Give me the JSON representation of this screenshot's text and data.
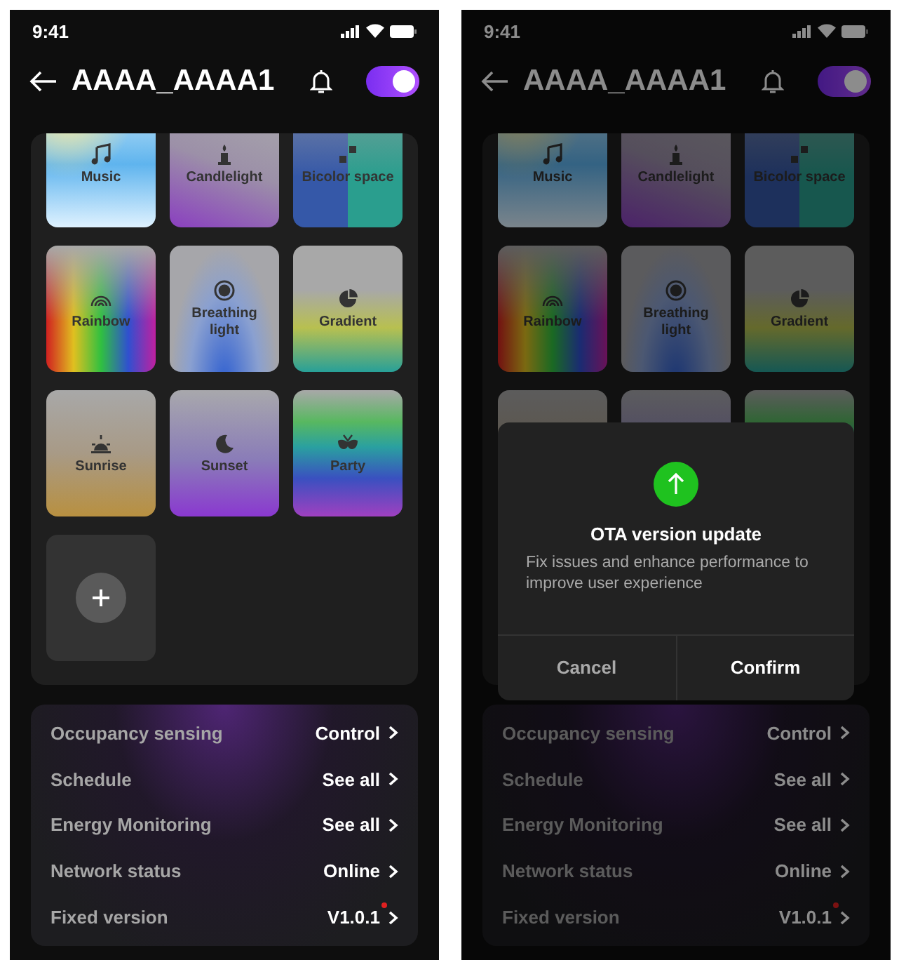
{
  "screens": [
    {
      "status_bar": {
        "time": "9:41"
      },
      "header": {
        "title": "AAAA_AAAA1",
        "power_on": true
      },
      "tiles": [
        {
          "kind": "music",
          "label": "Music"
        },
        {
          "kind": "candle",
          "label": "Candlelight"
        },
        {
          "kind": "bicolor",
          "label": "Bicolor space"
        },
        {
          "kind": "rainbow",
          "label": "Rainbow"
        },
        {
          "kind": "breathing",
          "label": "Breathing light"
        },
        {
          "kind": "gradient",
          "label": "Gradient"
        },
        {
          "kind": "sunrise",
          "label": "Sunrise"
        },
        {
          "kind": "sunset",
          "label": "Sunset"
        },
        {
          "kind": "party",
          "label": "Party"
        }
      ],
      "settings": [
        {
          "label": "Occupancy sensing",
          "value": "Control",
          "update_dot": false
        },
        {
          "label": "Schedule",
          "value": "See all",
          "update_dot": false
        },
        {
          "label": "Energy Monitoring",
          "value": "See all",
          "update_dot": false
        },
        {
          "label": "Network status",
          "value": "Online",
          "update_dot": false
        },
        {
          "label": "Fixed version",
          "value": "V1.0.1",
          "update_dot": true
        }
      ]
    },
    {
      "status_bar": {
        "time": "9:41"
      },
      "header": {
        "title": "AAAA_AAAA1",
        "power_on": true
      },
      "tiles": [
        {
          "kind": "music",
          "label": "Music"
        },
        {
          "kind": "candle",
          "label": "Candlelight"
        },
        {
          "kind": "bicolor",
          "label": "Bicolor space"
        },
        {
          "kind": "rainbow",
          "label": "Rainbow"
        },
        {
          "kind": "breathing",
          "label": "Breathing light"
        },
        {
          "kind": "gradient",
          "label": "Gradient"
        },
        {
          "kind": "sunrise"
        },
        {
          "kind": "sunset"
        },
        {
          "kind": "party"
        }
      ],
      "settings": [
        {
          "label": "Occupancy sensing",
          "value": "Control",
          "update_dot": false
        },
        {
          "label": "Schedule",
          "value": "See all",
          "update_dot": false
        },
        {
          "label": "Energy Monitoring",
          "value": "See all",
          "update_dot": false
        },
        {
          "label": "Network status",
          "value": "Online",
          "update_dot": false
        },
        {
          "label": "Fixed version",
          "value": "V1.0.1",
          "update_dot": true
        }
      ],
      "dialog": {
        "title": "OTA version update",
        "message": "Fix issues and enhance performance to improve user experience",
        "buttons": [
          {
            "label": "Cancel",
            "kind": "cancel"
          },
          {
            "label": "Confirm",
            "kind": "confirm"
          }
        ]
      }
    }
  ]
}
